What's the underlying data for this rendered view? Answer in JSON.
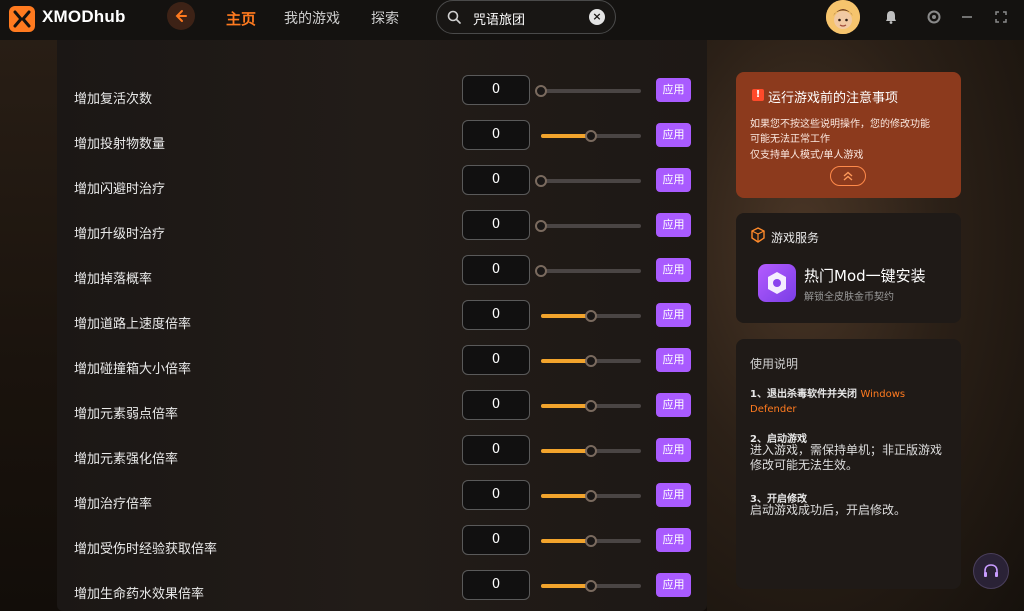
{
  "app": {
    "brand": "XMODhub"
  },
  "nav": {
    "items": [
      {
        "label": "主页",
        "active": true
      },
      {
        "label": "我的游戏",
        "active": false
      },
      {
        "label": "探索",
        "active": false
      }
    ]
  },
  "search": {
    "value": "咒语旅团",
    "clear_glyph": "×"
  },
  "window_controls": [
    "minimize-icon",
    "maximize-icon",
    "close-icon"
  ],
  "mods": {
    "apply_label": "应用",
    "rows": [
      {
        "label": "增加复活次数",
        "value": "0",
        "slider_fraction": 0.0
      },
      {
        "label": "增加投射物数量",
        "value": "0",
        "slider_fraction": 0.5
      },
      {
        "label": "增加闪避时治疗",
        "value": "0",
        "slider_fraction": 0.0
      },
      {
        "label": "增加升级时治疗",
        "value": "0",
        "slider_fraction": 0.0
      },
      {
        "label": "增加掉落概率",
        "value": "0",
        "slider_fraction": 0.0
      },
      {
        "label": "增加道路上速度倍率",
        "value": "0",
        "slider_fraction": 0.5
      },
      {
        "label": "增加碰撞箱大小倍率",
        "value": "0",
        "slider_fraction": 0.5
      },
      {
        "label": "增加元素弱点倍率",
        "value": "0",
        "slider_fraction": 0.5
      },
      {
        "label": "增加元素强化倍率",
        "value": "0",
        "slider_fraction": 0.5
      },
      {
        "label": "增加治疗倍率",
        "value": "0",
        "slider_fraction": 0.5
      },
      {
        "label": "增加受伤时经验获取倍率",
        "value": "0",
        "slider_fraction": 0.5
      },
      {
        "label": "增加生命药水效果倍率",
        "value": "0",
        "slider_fraction": 0.5
      }
    ]
  },
  "notice": {
    "icon": "!",
    "title": "运行游戏前的注意事项",
    "lines": [
      "如果您不按这些说明操作，您的修改功能",
      "可能无法正常工作",
      "仅支持单人模式/单人游戏"
    ]
  },
  "services": {
    "title": "游戏服务",
    "item_title": "热门Mod一键安装",
    "item_subtitle": "解锁全皮肤金币契约"
  },
  "instructions": {
    "title": "使用说明",
    "step1_heading": "1、退出杀毒软件并关闭",
    "step1_highlight": "Windows Defender",
    "step2_heading": "2、启动游戏",
    "step2_body": "进入游戏，需保持单机；非正版游戏修改可能无法生效。",
    "step3_heading": "3、开启修改",
    "step3_body": "启动游戏成功后，开启修改。"
  },
  "colors": {
    "accent": "#ff7a1f",
    "apply_button": "#a95bff",
    "slider_fill": "#f2a42c",
    "notice_bg": "#8c3a1d"
  }
}
